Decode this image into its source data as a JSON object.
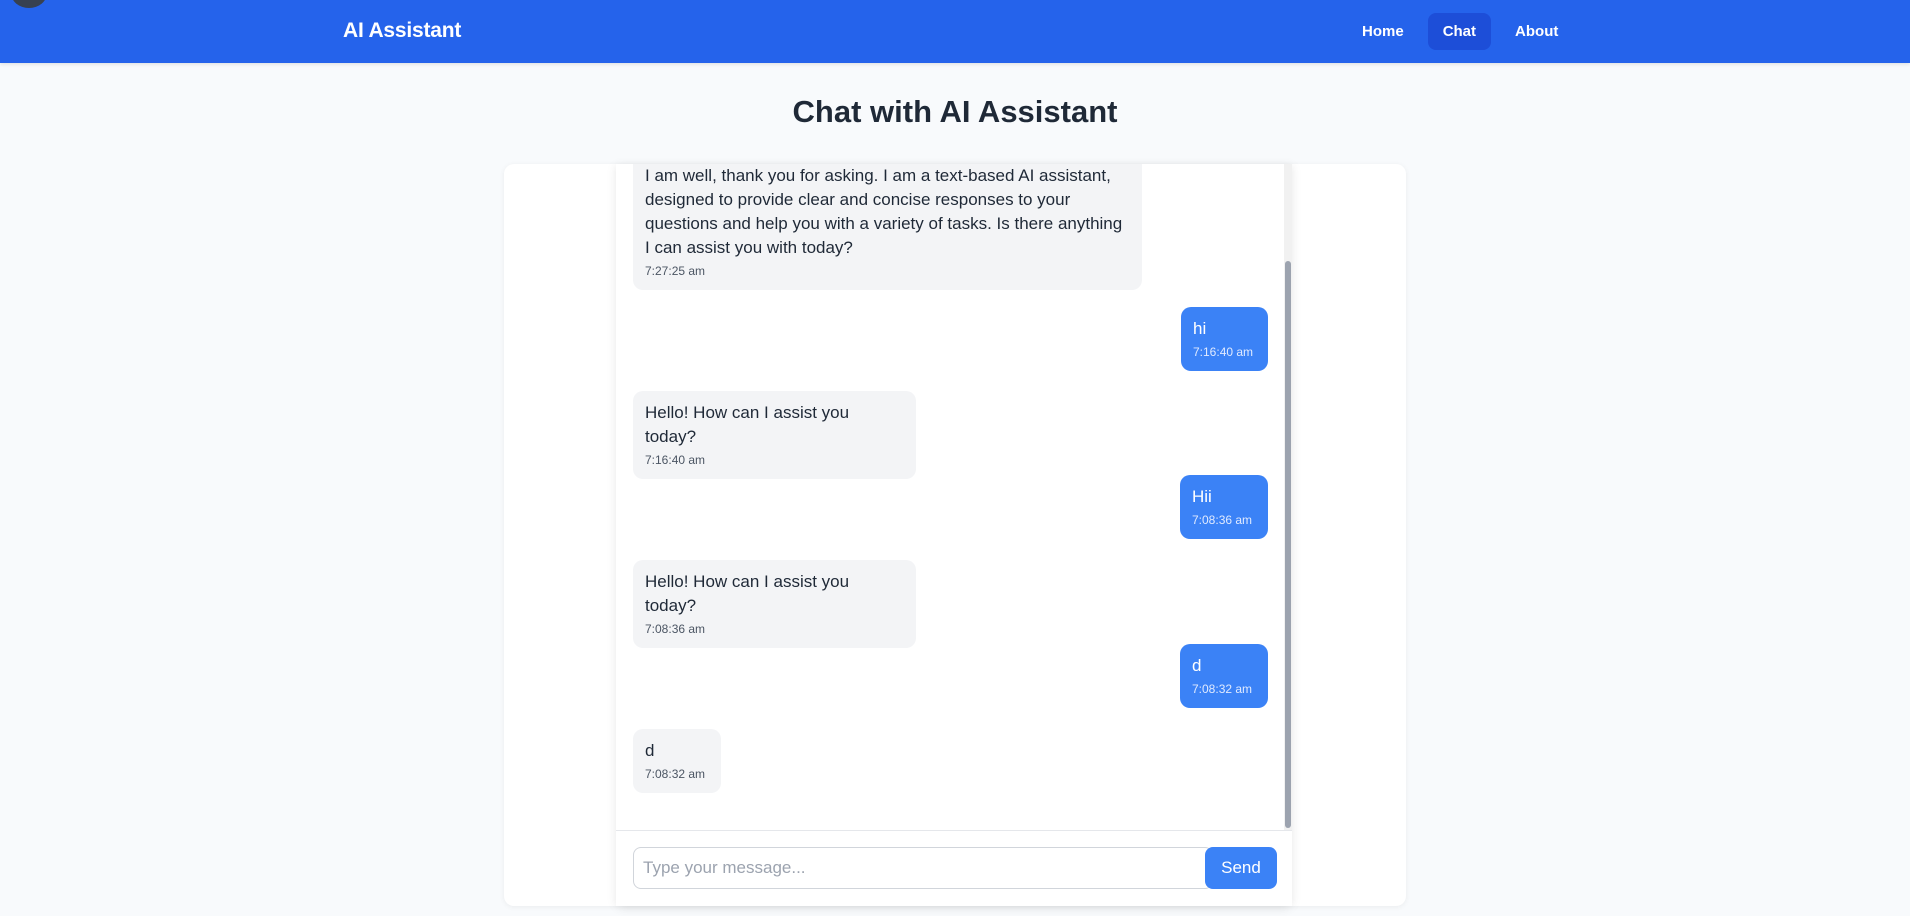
{
  "header": {
    "brand": "AI Assistant",
    "nav": [
      {
        "label": "Home",
        "active": false
      },
      {
        "label": "Chat",
        "active": true
      },
      {
        "label": "About",
        "active": false
      }
    ]
  },
  "page": {
    "title": "Chat with AI Assistant"
  },
  "chat": {
    "messages": [
      {
        "sender": "assistant",
        "text": "I am well, thank you for asking. I am a text-based AI assistant, designed to provide clear and concise responses to your questions and help you with a variety of tasks. Is there anything I can assist you with today?",
        "time": "7:27:25 am"
      },
      {
        "sender": "user",
        "text": "hi",
        "time": "7:16:40 am"
      },
      {
        "sender": "assistant",
        "text": "Hello! How can I assist you today?",
        "time": "7:16:40 am"
      },
      {
        "sender": "user",
        "text": "Hii",
        "time": "7:08:36 am"
      },
      {
        "sender": "assistant",
        "text": "Hello! How can I assist you today?",
        "time": "7:08:36 am"
      },
      {
        "sender": "user",
        "text": "d",
        "time": "7:08:32 am"
      },
      {
        "sender": "assistant",
        "text": "d",
        "time": "7:08:32 am"
      }
    ],
    "input": {
      "value": "",
      "placeholder": "Type your message..."
    },
    "send_label": "Send"
  },
  "colors": {
    "primary": "#2563eb",
    "nav_active": "#1d4ed8",
    "user_bubble": "#3b82f6",
    "assistant_bubble": "#f3f4f6"
  }
}
